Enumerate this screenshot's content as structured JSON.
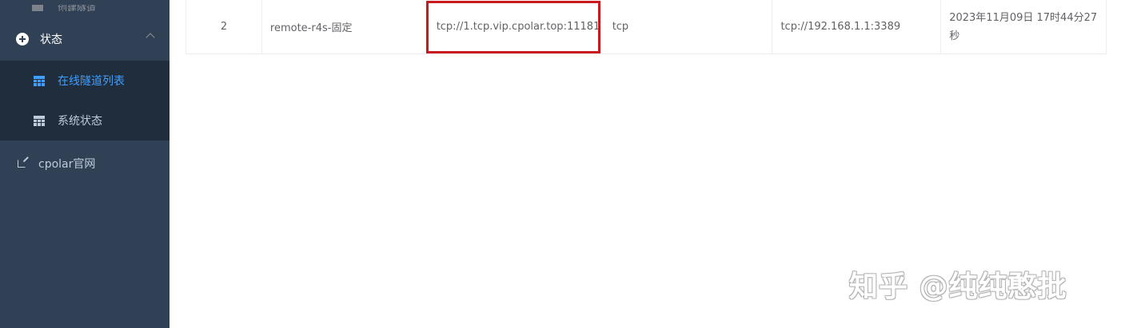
{
  "sidebar": {
    "prev_item_label": "创建隧道",
    "status_group": {
      "icon": "plus-circle-icon",
      "label": "状态"
    },
    "submenu": [
      {
        "icon": "table-icon",
        "label": "在线隧道列表",
        "active": true
      },
      {
        "icon": "table-icon",
        "label": "系统状态",
        "active": false
      }
    ],
    "link": {
      "icon": "external-link-icon",
      "label": "cpolar官网"
    },
    "colors": {
      "background": "#304156",
      "submenu_background": "#1f2d3d",
      "active": "#409eff",
      "text": "#bfcbd9"
    }
  },
  "table": {
    "row": {
      "index": "2",
      "name": "remote-r4s-固定",
      "public_url": "tcp://1.tcp.vip.cpolar.top:11181",
      "protocol": "tcp",
      "local_addr": "tcp://192.168.1.1:3389",
      "created": "2023年11月09日 17时44分27秒"
    }
  },
  "annotation": {
    "highlight_color": "#c8191f"
  },
  "watermark": "知乎 @纯纯憨批"
}
